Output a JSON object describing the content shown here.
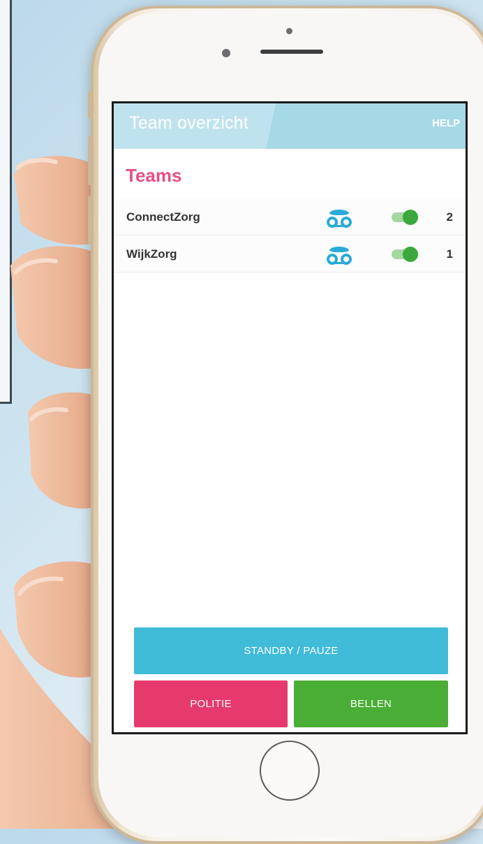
{
  "header": {
    "title": "Team overzicht",
    "help_label": "HELP"
  },
  "section_title": "Teams",
  "teams": [
    {
      "name": "ConnectZorg",
      "count": "2",
      "active": true,
      "phone_icon": "voicemail-phone-icon"
    },
    {
      "name": "WijkZorg",
      "count": "1",
      "active": true,
      "phone_icon": "voicemail-phone-icon"
    }
  ],
  "buttons": {
    "standby": "STANDBY / PAUZE",
    "politie": "POLITIE",
    "bellen": "BELLEN"
  },
  "colors": {
    "header_bg": "#a7d8e6",
    "accent_pink": "#e84f86",
    "icon_blue": "#2aaad6",
    "toggle_green": "#3aa83c",
    "standby_blue": "#40bbd8",
    "politie_red": "#e53a6b",
    "bellen_green": "#4aad36"
  }
}
